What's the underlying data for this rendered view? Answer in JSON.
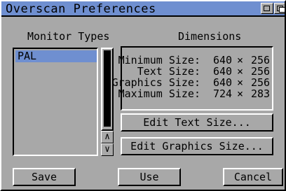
{
  "window": {
    "title": "Overscan Preferences"
  },
  "monitor_types": {
    "heading": "Monitor Types",
    "items": [
      "PAL"
    ],
    "scroll_up": "∧",
    "scroll_down": "∨"
  },
  "dimensions": {
    "heading": "Dimensions",
    "rows": [
      {
        "label": "Minimum Size:",
        "width": "640",
        "times": "×",
        "height": "256"
      },
      {
        "label": "Text Size:",
        "width": "640",
        "times": "×",
        "height": "256"
      },
      {
        "label": "Graphics Size:",
        "width": "640",
        "times": "×",
        "height": "256"
      },
      {
        "label": "Maximum Size:",
        "width": "724",
        "times": "×",
        "height": "283"
      }
    ],
    "edit_text_label": "Edit Text Size...",
    "edit_graphics_label": "Edit Graphics Size..."
  },
  "buttons": {
    "save": "Save",
    "use": "Use",
    "cancel": "Cancel"
  },
  "colors": {
    "background": "#a8a8a8",
    "accent": "#6f8fd0"
  }
}
